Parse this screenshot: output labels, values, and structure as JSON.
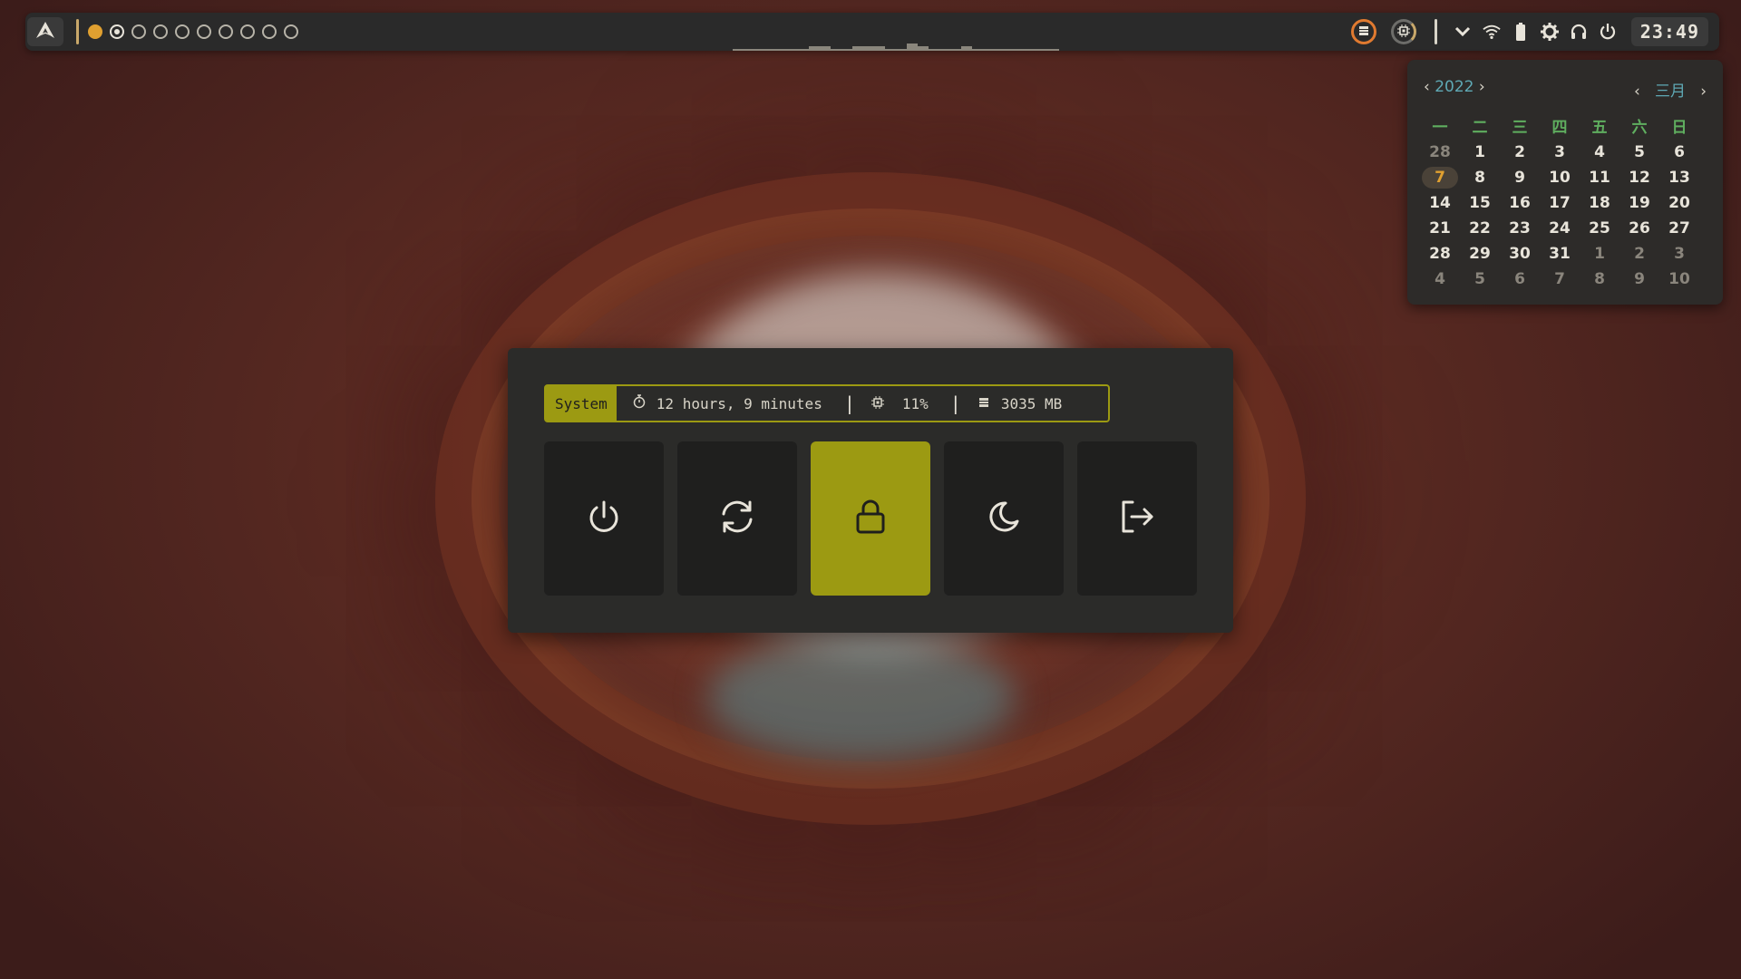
{
  "topbar": {
    "launcher_icon": "arch-logo-icon",
    "workspaces": [
      {
        "state": "active"
      },
      {
        "state": "focused"
      },
      {
        "state": "empty"
      },
      {
        "state": "empty"
      },
      {
        "state": "empty"
      },
      {
        "state": "empty"
      },
      {
        "state": "empty"
      },
      {
        "state": "empty"
      },
      {
        "state": "empty"
      },
      {
        "state": "empty"
      }
    ],
    "tray_icons": [
      "memory-icon",
      "cpu-icon",
      "chevron-down-icon",
      "wifi-icon",
      "battery-icon",
      "settings-gear-icon",
      "headphones-icon",
      "power-icon"
    ],
    "clock": "23:49"
  },
  "calendar": {
    "year": "2022",
    "month": "三月",
    "weekdays": [
      "一",
      "二",
      "三",
      "四",
      "五",
      "六",
      "日"
    ],
    "weeks": [
      [
        {
          "d": "28",
          "dim": true
        },
        {
          "d": "1"
        },
        {
          "d": "2"
        },
        {
          "d": "3"
        },
        {
          "d": "4"
        },
        {
          "d": "5"
        },
        {
          "d": "6"
        }
      ],
      [
        {
          "d": "7",
          "today": true
        },
        {
          "d": "8"
        },
        {
          "d": "9"
        },
        {
          "d": "10"
        },
        {
          "d": "11"
        },
        {
          "d": "12"
        },
        {
          "d": "13"
        }
      ],
      [
        {
          "d": "14"
        },
        {
          "d": "15"
        },
        {
          "d": "16"
        },
        {
          "d": "17"
        },
        {
          "d": "18"
        },
        {
          "d": "19"
        },
        {
          "d": "20"
        }
      ],
      [
        {
          "d": "21"
        },
        {
          "d": "22"
        },
        {
          "d": "23"
        },
        {
          "d": "24"
        },
        {
          "d": "25"
        },
        {
          "d": "26"
        },
        {
          "d": "27"
        }
      ],
      [
        {
          "d": "28"
        },
        {
          "d": "29"
        },
        {
          "d": "30"
        },
        {
          "d": "31"
        },
        {
          "d": "1",
          "dim": true
        },
        {
          "d": "2",
          "dim": true
        },
        {
          "d": "3",
          "dim": true
        }
      ],
      [
        {
          "d": "4",
          "dim": true
        },
        {
          "d": "5",
          "dim": true
        },
        {
          "d": "6",
          "dim": true
        },
        {
          "d": "7",
          "dim": true
        },
        {
          "d": "8",
          "dim": true
        },
        {
          "d": "9",
          "dim": true
        },
        {
          "d": "10",
          "dim": true
        }
      ]
    ]
  },
  "powermenu": {
    "label": "System",
    "uptime": "12 hours, 9 minutes",
    "cpu": "11%",
    "memory": "3035 MB",
    "separator": "|",
    "buttons": [
      {
        "name": "shutdown",
        "icon": "power-icon"
      },
      {
        "name": "reboot",
        "icon": "refresh-icon"
      },
      {
        "name": "lock",
        "icon": "lock-icon",
        "selected": true
      },
      {
        "name": "suspend",
        "icon": "moon-icon"
      },
      {
        "name": "logout",
        "icon": "logout-icon"
      }
    ],
    "accent": "#9c9a12"
  },
  "colors": {
    "bar_bg": "#2a2a2a",
    "panel_bg": "#2b2b29",
    "button_bg": "#1f1f1e",
    "workspace_active": "#e0a030",
    "calendar_accent": "#5fa9b5",
    "weekday": "#5fae5f"
  }
}
